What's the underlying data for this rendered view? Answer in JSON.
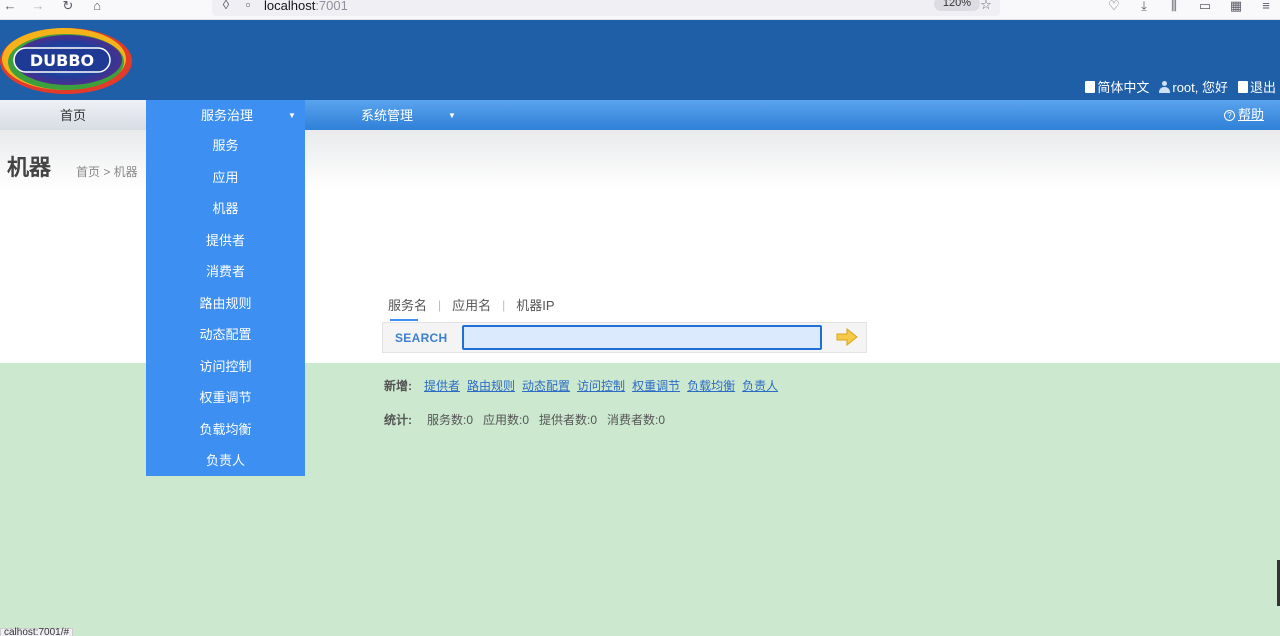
{
  "browser": {
    "url_host": "localhost",
    "url_port": ":7001",
    "zoom": "120%"
  },
  "header": {
    "logo_text": "DUBBO",
    "language": "简体中文",
    "user": "root, 您好",
    "logout": "退出"
  },
  "nav": {
    "home": "首页",
    "service_governance": "服务治理",
    "system_management": "系统管理",
    "help": "帮助"
  },
  "dropdown": {
    "items": [
      "服务",
      "应用",
      "机器",
      "提供者",
      "消费者",
      "路由规则",
      "动态配置",
      "访问控制",
      "权重调节",
      "负载均衡",
      "负责人"
    ]
  },
  "page": {
    "title": "机器",
    "breadcrumb": "首页 > 机器"
  },
  "search": {
    "tabs": [
      "服务名",
      "应用名",
      "机器IP"
    ],
    "label": "SEARCH",
    "value": ""
  },
  "new_links": {
    "label": "新增:",
    "items": [
      "提供者",
      "路由规则",
      "动态配置",
      "访问控制",
      "权重调节",
      "负载均衡",
      "负责人"
    ]
  },
  "stats": {
    "label": "统计:",
    "services": "服务数:0",
    "apps": "应用数:0",
    "providers": "提供者数:0",
    "consumers": "消费者数:0"
  },
  "status_bar": {
    "url": "calhost:7001/#"
  },
  "colors": {
    "header_bg": "#1f5fa8",
    "nav_bg": "#3d8ff2",
    "body_bg": "#cce8cf"
  }
}
